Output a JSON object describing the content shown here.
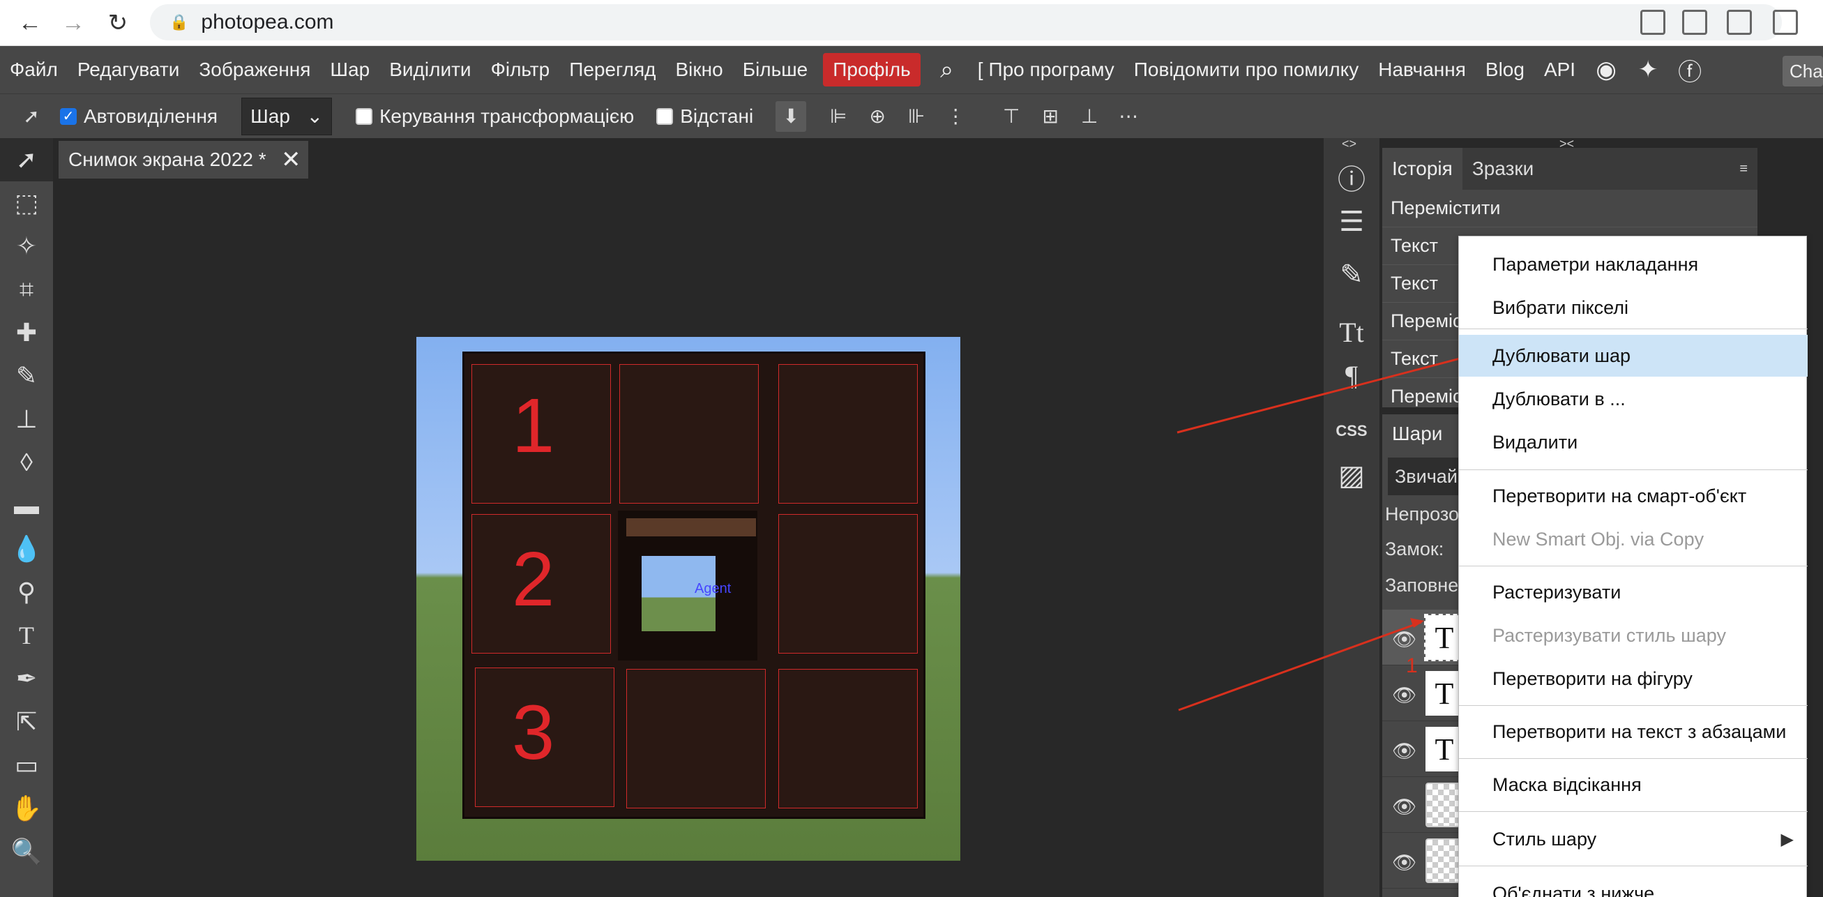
{
  "browser": {
    "url": "photopea.com"
  },
  "menu": {
    "items": [
      "Файл",
      "Редагувати",
      "Зображення",
      "Шар",
      "Виділити",
      "Фільтр",
      "Перегляд",
      "Вікно",
      "Більше"
    ],
    "profile": "Профіль",
    "about": "Про програму",
    "report": "Повідомити про помилку",
    "learn": "Навчання",
    "blog": "Blog",
    "api": "API",
    "chat": "Cha",
    "accent": "#c92b2b"
  },
  "options": {
    "autoselect": "Автовиділення",
    "autoselect_checked": true,
    "target": "Шар",
    "transform": "Керування трансформацією",
    "distances": "Відстані"
  },
  "document": {
    "tab_title": "Снимок экрана 2022 *"
  },
  "canvas": {
    "slot_numbers": [
      "1",
      "2",
      "3"
    ],
    "agent_label": "Agent"
  },
  "history": {
    "tabs": [
      "Історія",
      "Зразки"
    ],
    "rows": [
      "Перемістити",
      "Текст",
      "Текст",
      "Перемістити",
      "Текст",
      "Перемістити"
    ]
  },
  "layers": {
    "tab": "Шари",
    "blend": "Звичайний",
    "opacity": "Непрозорість",
    "lock": "Замок:",
    "fill": "Заповнення"
  },
  "annotations": {
    "label1": "1",
    "label2": "2",
    "color": "#d8301d"
  },
  "context_menu": {
    "items": [
      {
        "label": "Параметри накладання",
        "disabled": false
      },
      {
        "label": "Вибрати пікселі",
        "disabled": false
      },
      {
        "label": "Дублювати шар",
        "disabled": false,
        "highlighted": true
      },
      {
        "label": "Дублювати в ...",
        "disabled": false
      },
      {
        "label": "Видалити",
        "disabled": false
      },
      {
        "label": "Перетворити на смарт-об'єкт",
        "disabled": false
      },
      {
        "label": "New Smart Obj. via Copy",
        "disabled": true
      },
      {
        "label": "Растеризувати",
        "disabled": false
      },
      {
        "label": "Растеризувати стиль шару",
        "disabled": true
      },
      {
        "label": "Перетворити на фігуру",
        "disabled": false
      },
      {
        "label": "Перетворити на текст з абзацами",
        "disabled": false
      },
      {
        "label": "Маска відсікання",
        "disabled": false
      },
      {
        "label": "Стиль шару",
        "disabled": false
      },
      {
        "label": "Об'єднати з нижче",
        "disabled": false
      }
    ]
  }
}
